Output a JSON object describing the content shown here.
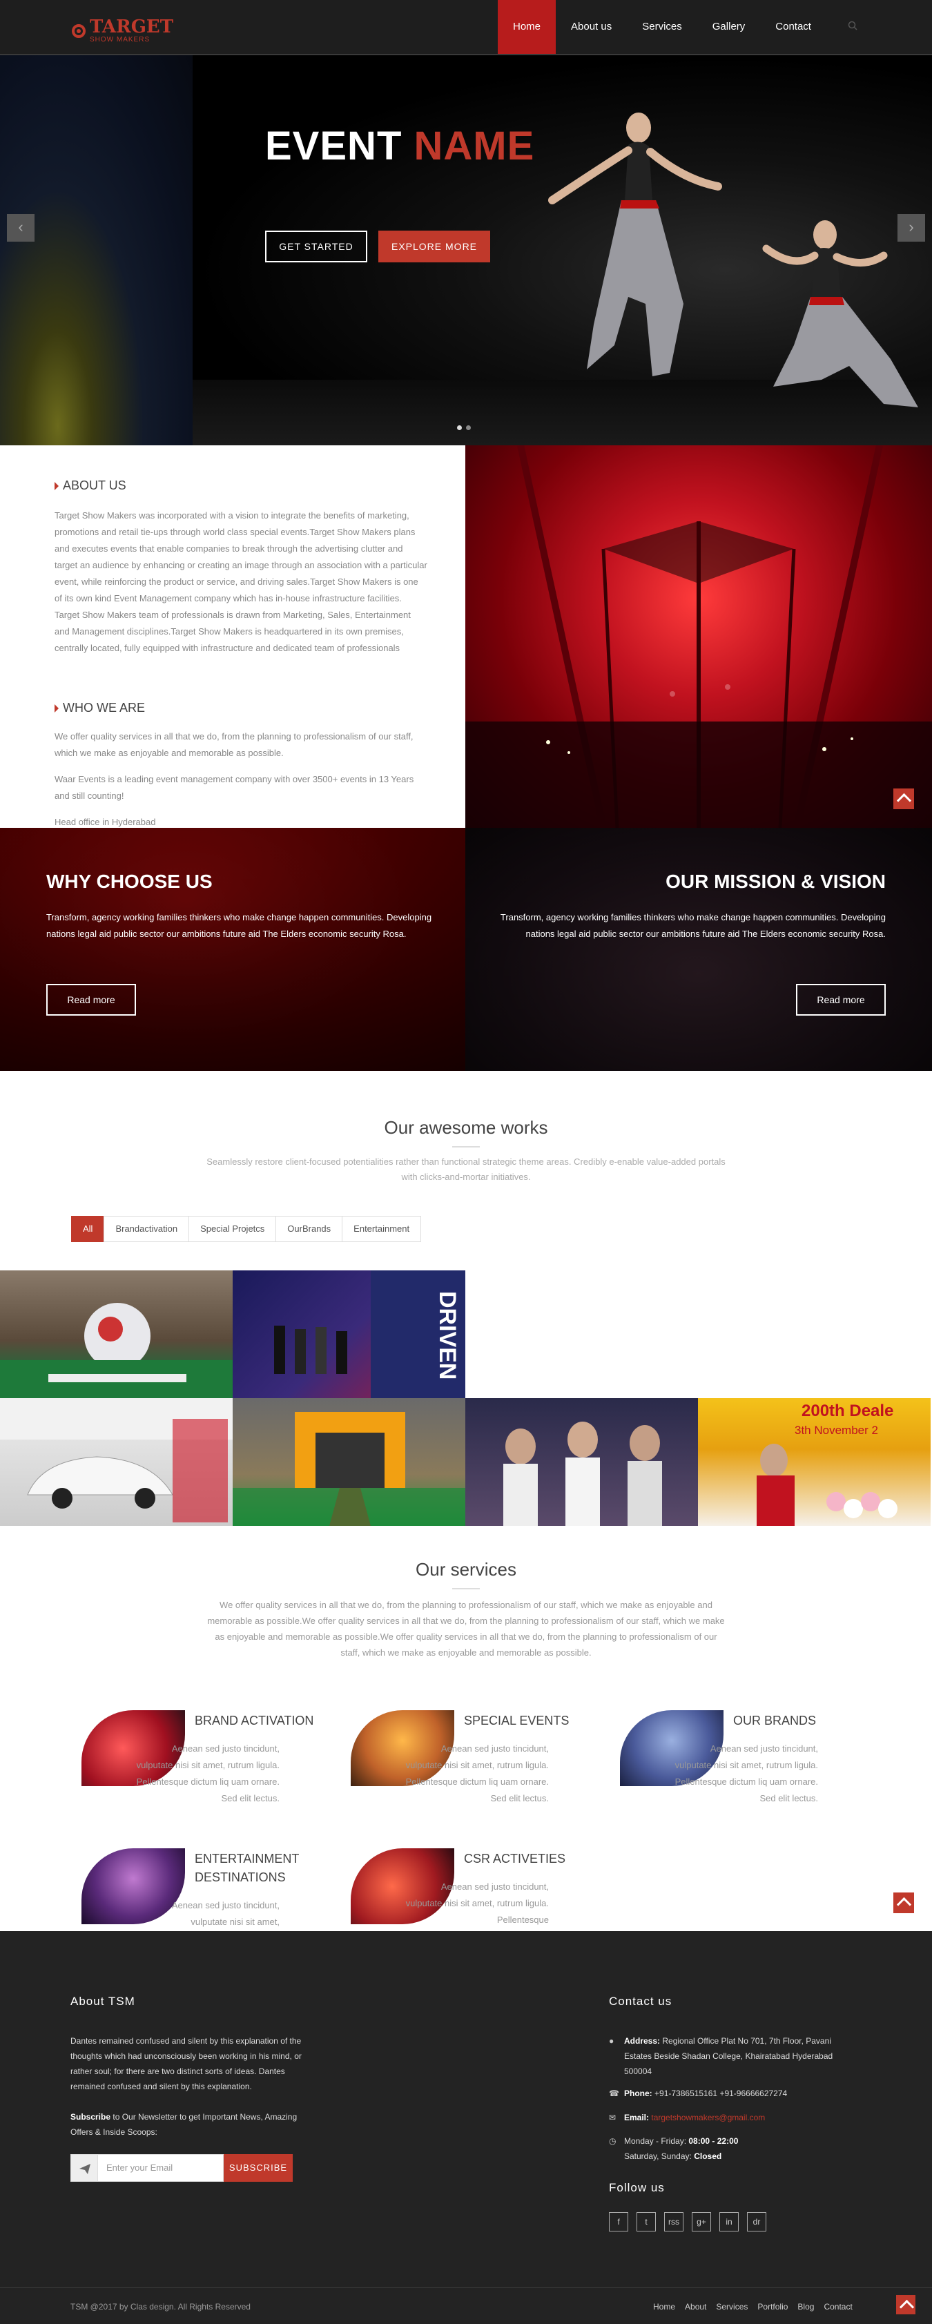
{
  "nav": {
    "logo_title": "TARGET",
    "logo_subtitle": "SHOW MAKERS",
    "items": [
      {
        "label": "Home"
      },
      {
        "label": "About us"
      },
      {
        "label": "Services"
      },
      {
        "label": "Gallery"
      },
      {
        "label": "Contact"
      }
    ],
    "active": "Home",
    "search_icon": "search-icon"
  },
  "hero": {
    "title_white": "EVENT",
    "title_red": "NAME",
    "btn_primary": "GET STARTED",
    "btn_secondary": "EXPLORE MORE",
    "prev": "‹",
    "next": "›"
  },
  "about": {
    "heading": "ABOUT US",
    "text": "Target Show Makers was incorporated with a vision to integrate the benefits of marketing, promotions and retail tie-ups through world class special events.Target Show Makers plans and executes events that enable companies to break through the advertising clutter and target an audience by enhancing or creating an image through an association with a particular event, while reinforcing the product or service, and driving sales.Target Show Makers is one of its own kind Event Management company which has in-house infrastructure facilities. Target Show Makers team of professionals is drawn from Marketing, Sales, Entertainment and Management disciplines.Target Show Makers is headquartered in its own premises, centrally located, fully equipped with infrastructure and dedicated team of professionals",
    "who_heading": "WHO WE ARE",
    "who_p1": "We offer quality services in all that we do, from the planning to professionalism of our staff, which we make as enjoyable and memorable as possible.",
    "who_p2": "Waar Events is a leading event management company with over 3500+ events in 13 Years and still counting!",
    "who_p3": "Head office in Hyderabad"
  },
  "why": {
    "heading": "WHY CHOOSE US",
    "text": "Transform, agency working families thinkers who make change happen communities. Developing nations legal aid public sector our ambitions future aid The Elders economic security Rosa.",
    "button": "Read more"
  },
  "mission": {
    "heading": "OUR MISSION & VISION",
    "text": "Transform, agency working families thinkers who make change happen communities. Developing nations legal aid public sector our ambitions future aid The Elders economic security Rosa.",
    "button": "Read more"
  },
  "works": {
    "heading": "Our awesome works",
    "subtitle": "Seamlessly restore client-focused potentialities rather than functional strategic theme areas. Credibly e-enable value-added portals with clicks-and-mortar initiatives.",
    "filters": [
      "All",
      "Brandactivation",
      "Special Projetcs",
      "OurBrands",
      "Entertainment"
    ],
    "active_filter": "All",
    "tiles": [
      {
        "name": "globe-activation-tile"
      },
      {
        "name": "driven-stage-tile"
      },
      {
        "name": "car-showroom-tile"
      },
      {
        "name": "entrance-arch-tile"
      },
      {
        "name": "models-tile"
      },
      {
        "name": "dealers-meet-tile"
      }
    ],
    "dealer_banner": "200th Deale",
    "dealer_banner2": "3th November 2"
  },
  "services": {
    "heading": "Our services",
    "intro": "We offer quality services in all that we do, from the planning to professionalism of our staff, which we make as enjoyable and memorable as possible.We offer quality services in all that we do, from the planning to professionalism of our staff, which we make as enjoyable and memorable as possible.We offer quality services in all that we do, from the planning to professionalism of our staff, which we make as enjoyable and memorable as possible.",
    "items": [
      {
        "title": "BRAND ACTIVATION",
        "text": "Aenean sed justo tincidunt, vulputate nisi sit amet, rutrum ligula. Pellentesque dictum liq uam ornare. Sed elit lectus."
      },
      {
        "title": "SPECIAL EVENTS",
        "text": "Aenean sed justo tincidunt, vulputate nisi sit amet, rutrum ligula. Pellentesque dictum liq uam ornare. Sed elit lectus."
      },
      {
        "title": "OUR BRANDS",
        "text": "Aenean sed justo tincidunt, vulputate nisi sit amet, rutrum ligula. Pellentesque dictum liq uam ornare. Sed elit lectus."
      },
      {
        "title": "ENTERTAINMENT DESTINATIONS",
        "text": "Aenean sed justo tincidunt, vulputate nisi sit amet,"
      },
      {
        "title": "CSR ACTIVETIES",
        "text": "Aenean sed justo tincidunt, vulputate nisi sit amet, rutrum ligula. Pellentesque"
      }
    ]
  },
  "footer": {
    "about_heading": "About TSM",
    "about_text": "Dantes remained confused and silent by this explanation of the thoughts which had unconsciously been working in his mind, or rather soul; for there are two distinct sorts of ideas. Dantes remained confused and silent by this explanation.",
    "subscribe_bold": "Subscribe",
    "subscribe_text": " to Our Newsletter to get Important News, Amazing Offers & Inside Scoops:",
    "email_placeholder": "Enter your Email",
    "subscribe_button": "SUBSCRIBE",
    "contact_heading": "Contact us",
    "address_label": "Address:",
    "address": "Regional Office Plat No 701, 7th Floor, Pavani Estates Beside Shadan College, Khairatabad Hyderabad 500004",
    "phone_label": "Phone:",
    "phone": "+91-7386515161 +91-96666627274",
    "email_label": "Email:",
    "email": "targetshowmakers@gmail.com",
    "hours_weekday": "Monday - Friday: ",
    "hours_weekday_time": "08:00 - 22:00",
    "hours_weekend": "Saturday, Sunday: ",
    "hours_weekend_status": "Closed",
    "follow_heading": "Follow us",
    "socials": [
      "f",
      "t",
      "rss",
      "g+",
      "in",
      "dr"
    ],
    "copyright": "TSM @2017 by Clas design. All Rights Reserved",
    "links": [
      "Home",
      "About",
      "Services",
      "Portfolio",
      "Blog",
      "Contact"
    ],
    "accent": "#c0392b"
  }
}
